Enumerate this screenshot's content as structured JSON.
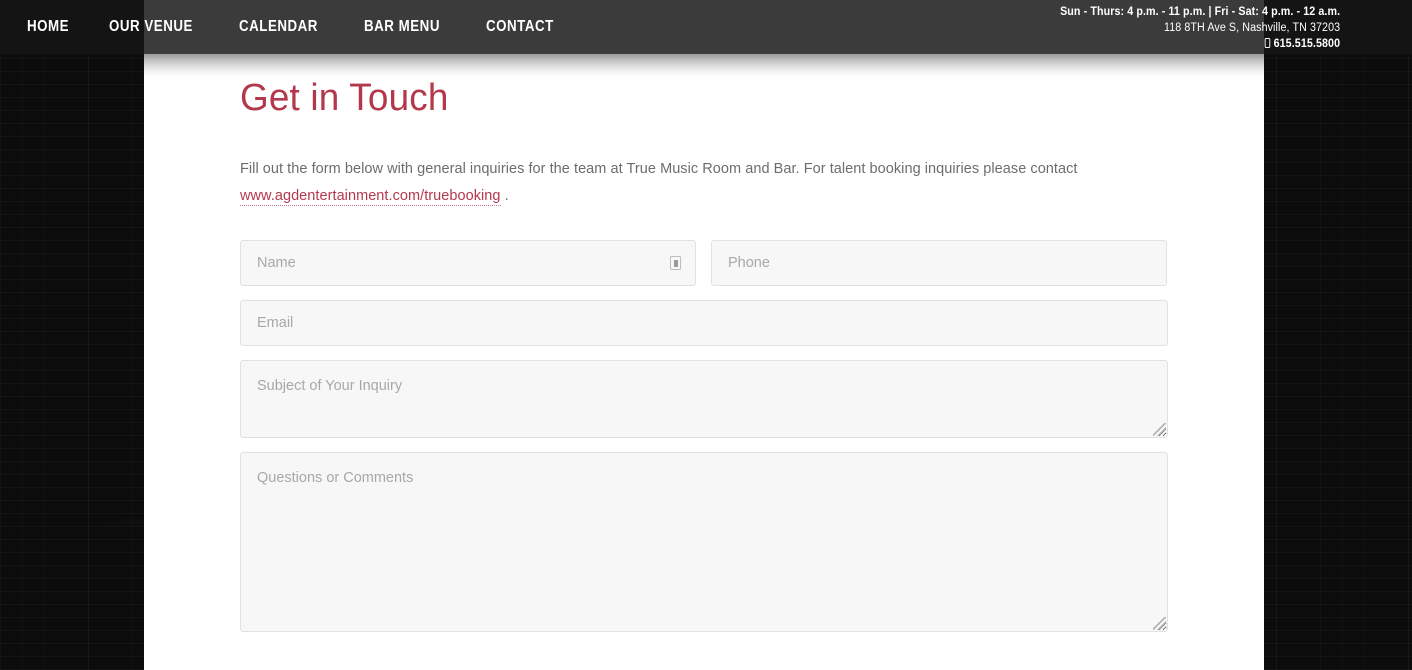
{
  "nav": {
    "links": [
      {
        "label": "HOME"
      },
      {
        "label": "OUR VENUE"
      },
      {
        "label": "CALENDAR"
      },
      {
        "label": "BAR MENU"
      },
      {
        "label": "CONTACT"
      }
    ],
    "info": {
      "hours": "Sun - Thurs: 4 p.m. - 11 p.m. | Fri - Sat: 4 p.m. - 12 a.m.",
      "address": "118 8TH Ave S, Nashville, TN 37203",
      "phone": "615.515.5800",
      "phone_icon": "mobile-phone-icon"
    }
  },
  "main": {
    "title": "Get in Touch",
    "intro_before": "Fill out the form below with general inquiries for the team at True Music Room and Bar. For talent booking inquiries please contact ",
    "intro_link": "www.agdentertainment.com/truebooking",
    "intro_after": " ."
  },
  "form": {
    "name": {
      "placeholder": "Name",
      "value": "",
      "icon": "contact-card-icon"
    },
    "phone": {
      "placeholder": "Phone",
      "value": ""
    },
    "email": {
      "placeholder": "Email",
      "value": ""
    },
    "subject": {
      "placeholder": "Subject of Your Inquiry",
      "value": ""
    },
    "questions": {
      "placeholder": "Questions or Comments",
      "value": ""
    }
  },
  "colors": {
    "accent": "#b4384b",
    "navbar": "#3b3b3b",
    "navbar_dark": "#151414",
    "field_bg": "#f7f7f7",
    "field_border": "#e2e2e2",
    "body_text": "#6d6d6d"
  }
}
